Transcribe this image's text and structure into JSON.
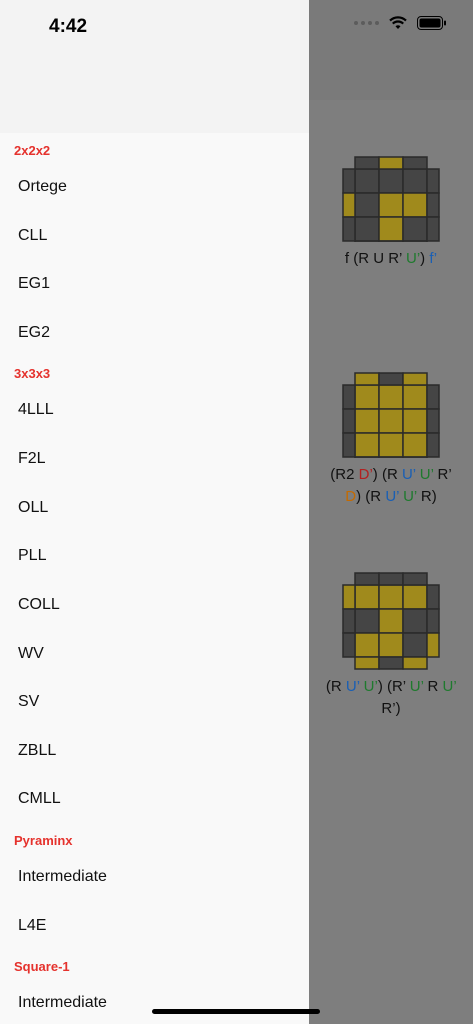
{
  "status_bar": {
    "time": "4:42"
  },
  "drawer": {
    "sections": [
      {
        "title": "2x2x2",
        "items": [
          "Ortege",
          "CLL",
          "EG1",
          "EG2"
        ]
      },
      {
        "title": "3x3x3",
        "items": [
          "4LLL",
          "F2L",
          "OLL",
          "PLL",
          "COLL",
          "WV",
          "SV",
          "ZBLL",
          "CMLL"
        ]
      },
      {
        "title": "Pyraminx",
        "items": [
          "Intermediate",
          "L4E"
        ]
      },
      {
        "title": "Square-1",
        "items": [
          "Intermediate"
        ]
      }
    ]
  },
  "cases": [
    {
      "alg_tokens": [
        {
          "t": "f (R U R’ ",
          "c": ""
        },
        {
          "t": "U’",
          "c": "g"
        },
        {
          "t": ") ",
          "c": ""
        },
        {
          "t": "f’",
          "c": "b"
        }
      ]
    },
    {
      "alg_tokens": [
        {
          "t": "(R2 ",
          "c": ""
        },
        {
          "t": "D’",
          "c": "r"
        },
        {
          "t": ") (R ",
          "c": ""
        },
        {
          "t": "U’",
          "c": "b"
        },
        {
          "t": " ",
          "c": ""
        },
        {
          "t": "U’",
          "c": "g"
        },
        {
          "t": " R’ ",
          "c": ""
        },
        {
          "t": "D",
          "c": "o"
        },
        {
          "t": ") (R ",
          "c": ""
        },
        {
          "t": "U’",
          "c": "b"
        },
        {
          "t": " ",
          "c": ""
        },
        {
          "t": "U’",
          "c": "g"
        },
        {
          "t": " R)",
          "c": ""
        }
      ]
    },
    {
      "alg_tokens": [
        {
          "t": "(R ",
          "c": ""
        },
        {
          "t": "U’",
          "c": "b"
        },
        {
          "t": " ",
          "c": ""
        },
        {
          "t": "U’",
          "c": "g"
        },
        {
          "t": ") (R’ ",
          "c": ""
        },
        {
          "t": "U’",
          "c": "g"
        },
        {
          "t": " R ",
          "c": ""
        },
        {
          "t": "U’",
          "c": "g"
        },
        {
          "t": " R’)",
          "c": ""
        }
      ]
    }
  ],
  "colors": {
    "accent": "#e5322d",
    "sticker_yellow": "#a08a1c",
    "sticker_gray": "#454545"
  }
}
